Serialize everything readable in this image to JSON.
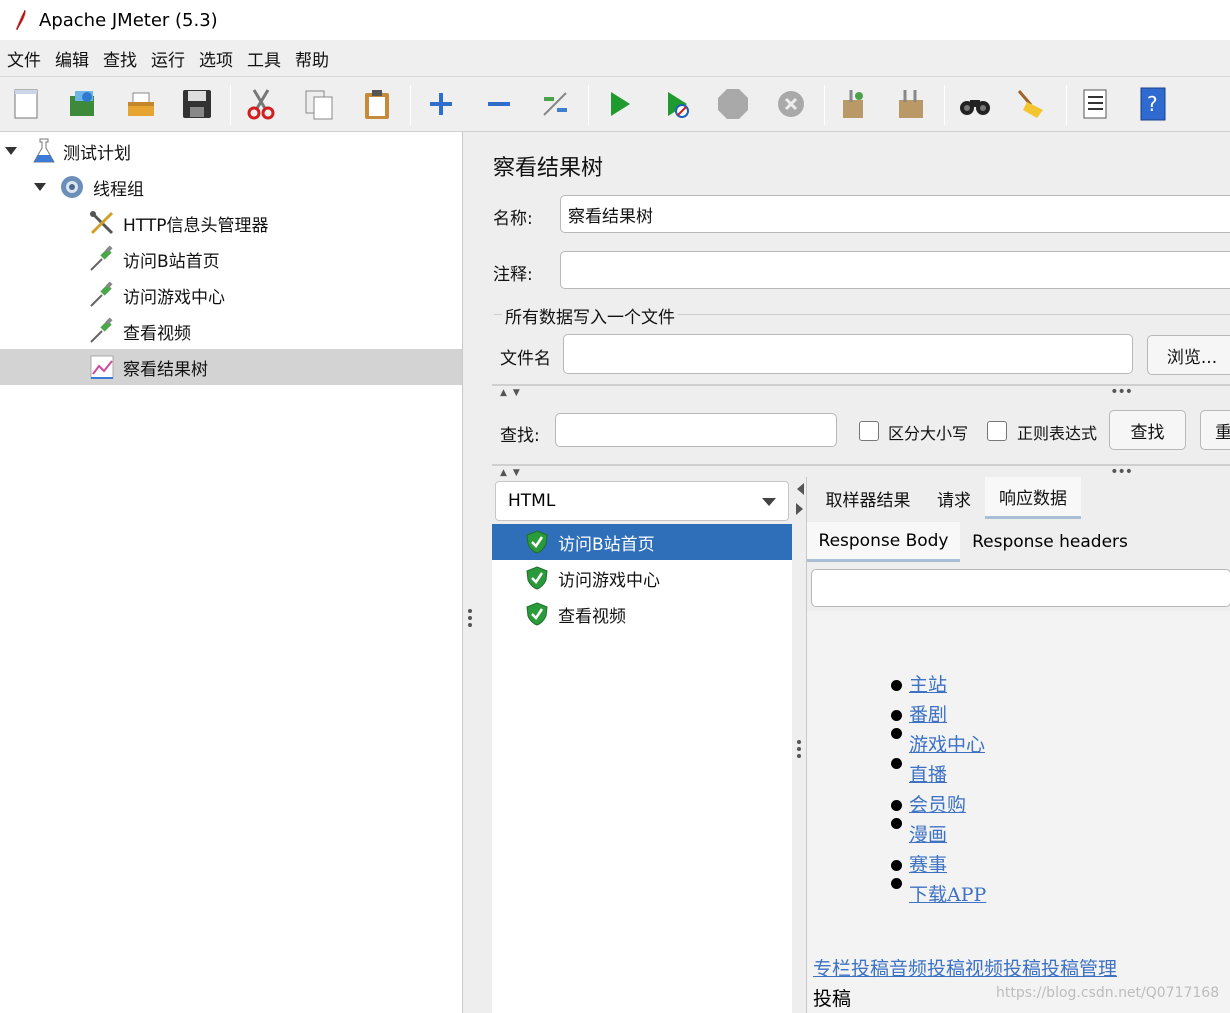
{
  "window": {
    "title": "Apache JMeter (5.3)"
  },
  "menu": [
    "文件",
    "编辑",
    "查找",
    "运行",
    "选项",
    "工具",
    "帮助"
  ],
  "toolbar_icons": [
    "new-icon",
    "templates-icon",
    "open-icon",
    "save-icon",
    "cut-icon",
    "copy-icon",
    "paste-icon",
    "expand-icon",
    "collapse-icon",
    "toggle-icon",
    "start-icon",
    "start-no-timers-icon",
    "stop-icon",
    "shutdown-icon",
    "clear-icon",
    "clear-all-icon",
    "search-icon",
    "reset-search-icon",
    "function-helper-icon",
    "help-icon"
  ],
  "tree": [
    {
      "label": "测试计划",
      "icon": "test-plan-icon"
    },
    {
      "label": "线程组",
      "icon": "thread-group-icon"
    },
    {
      "label": "HTTP信息头管理器",
      "icon": "header-manager-icon"
    },
    {
      "label": "访问B站首页",
      "icon": "http-sampler-icon"
    },
    {
      "label": "访问游戏中心",
      "icon": "http-sampler-icon"
    },
    {
      "label": "查看视频",
      "icon": "http-sampler-icon"
    },
    {
      "label": "察看结果树",
      "icon": "view-results-tree-icon"
    }
  ],
  "panel": {
    "title": "察看结果树",
    "name_label": "名称:",
    "name_value": "察看结果树",
    "comment_label": "注释:",
    "comment_value": "",
    "file_group": "所有数据写入一个文件",
    "filename_label": "文件名",
    "filename_value": "",
    "browse_label": "浏览...",
    "search_label": "查找:",
    "search_value": "",
    "case_label": "区分大小写",
    "regex_label": "正则表达式",
    "find_label": "查找",
    "reset_label": "重"
  },
  "results": {
    "renderer": "HTML",
    "samples": [
      "访问B站首页",
      "访问游戏中心",
      "查看视频"
    ],
    "tabs": [
      "取样器结果",
      "请求",
      "响应数据"
    ],
    "subtabs": [
      "Response Body",
      "Response headers"
    ],
    "html_nav": [
      "主站",
      "番剧",
      "游戏中心",
      "直播",
      "会员购",
      "漫画",
      "赛事",
      "下载APP"
    ],
    "footer_link": "专栏投稿音频投稿视频投稿投稿管理",
    "footer_text": "投稿"
  },
  "watermark": "https://blog.csdn.net/Q0717168"
}
